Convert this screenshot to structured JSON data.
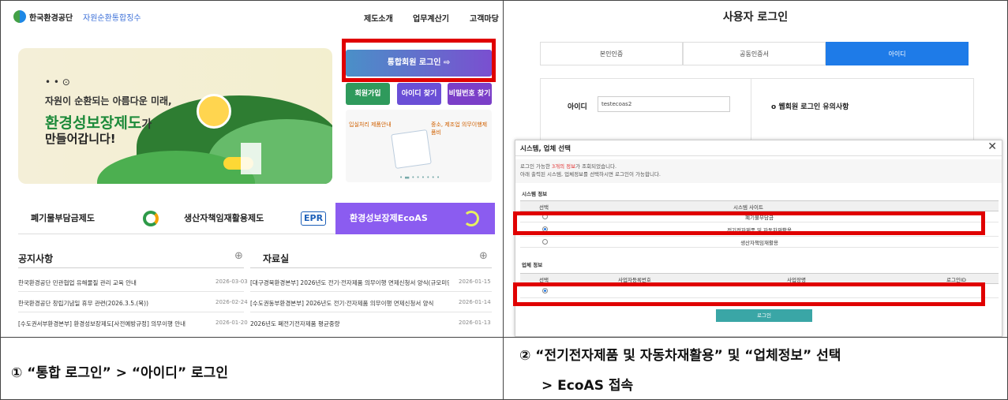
{
  "left_site": {
    "logo_text": "한국환경공단",
    "logo_sub": "자원순환통합징수",
    "nav": [
      "제도소개",
      "업무계산기",
      "고객마당"
    ],
    "hero": {
      "dots": "• • ⊙",
      "line1": "자원이 순환되는 아름다운 미래,",
      "line2_main": "환경성보장제도",
      "line2_suffix": "가",
      "line3": "만들어갑니다!"
    },
    "login_button": "통합회원 로그인 ⇨",
    "small_buttons": [
      {
        "label": "회원가입",
        "color": "#2f9a5c"
      },
      {
        "label": "아이디 찾기",
        "color": "#6a4fd6"
      },
      {
        "label": "비밀번호 찾기",
        "color": "#7b3fc8"
      }
    ],
    "card": {
      "t1": "입실처리 제품안내",
      "t2": "중소, 제조업 의무이행제품비",
      "dots": "• ▬ • • • • • •"
    },
    "tabs": [
      "폐기물부담금제도",
      "생산자책임재활용제도",
      "환경성보장제EcoAS"
    ],
    "tab_epr": "EPR",
    "notices_title": "공지사항",
    "notices": [
      {
        "text": "한국환경공단 민관협업 유해물질 관리 교육 안내",
        "date": "2026-03-03"
      },
      {
        "text": "한국환경공단 창립기념일 휴무 관련(2026.3.5.(목))",
        "date": "2026-02-24"
      },
      {
        "text": "[수도권서부환경본부] 환경성보장제도[사전예방규정] 의무이행 안내",
        "date": "2026-01-20"
      }
    ],
    "data_title": "자료실",
    "data_items": [
      {
        "text": "[대구경북환경본부] 2026년도 전기·전자제품 의무이행 면제신청서 양식(규모미만…",
        "date": "2026-01-15"
      },
      {
        "text": "[수도권동부환경본부] 2026년도 전기·전자제품 의무이행 면제신청서 양식",
        "date": "2026-01-14"
      },
      {
        "text": "2026년도 폐전기전자제품 평균중량",
        "date": "2026-01-13"
      }
    ]
  },
  "right_site": {
    "title": "사용자 로그인",
    "tabs": [
      "본인인증",
      "공동인증서",
      "아이디"
    ],
    "id_label": "아이디",
    "id_value": "testecoas2",
    "notice_label": "o 웹회원 로그인 유의사항",
    "modal": {
      "title": "시스템, 업체 선택",
      "close": "✕",
      "info1_a": "로그인 가능한 ",
      "info1_b": "3개의 정보",
      "info1_c": "가 조회되었습니다.",
      "info2": "아래 출력된 시스템, 업체정보를 선택하시면 로그인이 가능합니다.",
      "system_section": "시스템 정보",
      "system_headers": [
        "선택",
        "시스템 사이트"
      ],
      "systems": [
        "폐기물부담금",
        "전기전자제품 및 자동차재활용",
        "생산자책임재활용"
      ],
      "company_section": "업체 정보",
      "company_headers": [
        "선택",
        "사업자등록번호",
        "사업장명",
        "로그인ID"
      ],
      "login_button": "로그인"
    }
  },
  "captions": {
    "left": "① “통합 로그인” > “아이디” 로그인",
    "right_line1": "② “전기전자제품 및 자동차재활용” 및 “업체정보” 선택",
    "right_line2": "> EcoAS 접속"
  }
}
